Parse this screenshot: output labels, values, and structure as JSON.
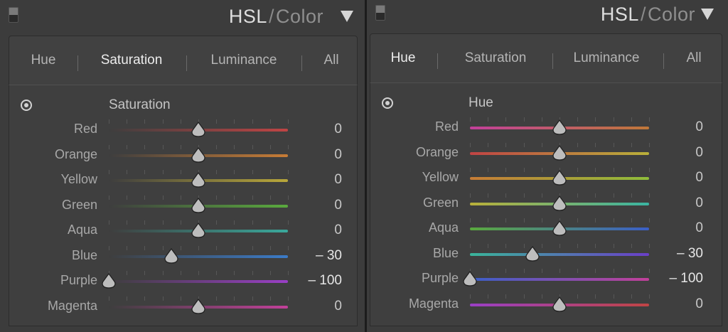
{
  "panels": [
    {
      "header": {
        "title_main": "HSL",
        "title_sep": "/",
        "title_alt": "Color"
      },
      "tabs": [
        "Hue",
        "Saturation",
        "Luminance",
        "All"
      ],
      "active_tab": 1,
      "section_title": "Saturation",
      "rows": [
        {
          "label": "Red",
          "value": "0",
          "fraction": 0.5,
          "gradient": [
            "#3e3e3e",
            "#c04444"
          ]
        },
        {
          "label": "Orange",
          "value": "0",
          "fraction": 0.5,
          "gradient": [
            "#3e3e3e",
            "#c77c36"
          ]
        },
        {
          "label": "Yellow",
          "value": "0",
          "fraction": 0.5,
          "gradient": [
            "#3e3e3e",
            "#b9a73a"
          ]
        },
        {
          "label": "Green",
          "value": "0",
          "fraction": 0.5,
          "gradient": [
            "#3e3e3e",
            "#5aaa3e"
          ]
        },
        {
          "label": "Aqua",
          "value": "0",
          "fraction": 0.5,
          "gradient": [
            "#3e3e3e",
            "#3aa99c"
          ]
        },
        {
          "label": "Blue",
          "value": "– 30",
          "fraction": 0.35,
          "gradient": [
            "#3e3e3e",
            "#3b7bc8"
          ]
        },
        {
          "label": "Purple",
          "value": "– 100",
          "fraction": 0.0,
          "gradient": [
            "#3e3e3e",
            "#9a3fc6"
          ]
        },
        {
          "label": "Magenta",
          "value": "0",
          "fraction": 0.5,
          "gradient": [
            "#3e3e3e",
            "#c2409a"
          ]
        }
      ]
    },
    {
      "header": {
        "title_main": "HSL",
        "title_sep": "/",
        "title_alt": "Color"
      },
      "tabs": [
        "Hue",
        "Saturation",
        "Luminance",
        "All"
      ],
      "active_tab": 0,
      "section_title": "Hue",
      "rows": [
        {
          "label": "Red",
          "value": "0",
          "fraction": 0.5,
          "gradient": [
            "#c2409a",
            "#c07838"
          ]
        },
        {
          "label": "Orange",
          "value": "0",
          "fraction": 0.5,
          "gradient": [
            "#c04444",
            "#b9b03a"
          ]
        },
        {
          "label": "Yellow",
          "value": "0",
          "fraction": 0.5,
          "gradient": [
            "#c77c36",
            "#8fbd3a"
          ]
        },
        {
          "label": "Green",
          "value": "0",
          "fraction": 0.5,
          "gradient": [
            "#b9b03a",
            "#3ab4a2"
          ]
        },
        {
          "label": "Aqua",
          "value": "0",
          "fraction": 0.5,
          "gradient": [
            "#5aaa3e",
            "#3b5fc8"
          ]
        },
        {
          "label": "Blue",
          "value": "– 30",
          "fraction": 0.35,
          "gradient": [
            "#3ab49a",
            "#6a3fc8"
          ]
        },
        {
          "label": "Purple",
          "value": "– 100",
          "fraction": 0.0,
          "gradient": [
            "#3b5fc8",
            "#c2409a"
          ]
        },
        {
          "label": "Magenta",
          "value": "0",
          "fraction": 0.5,
          "gradient": [
            "#9a3fc6",
            "#c04444"
          ]
        }
      ]
    }
  ]
}
